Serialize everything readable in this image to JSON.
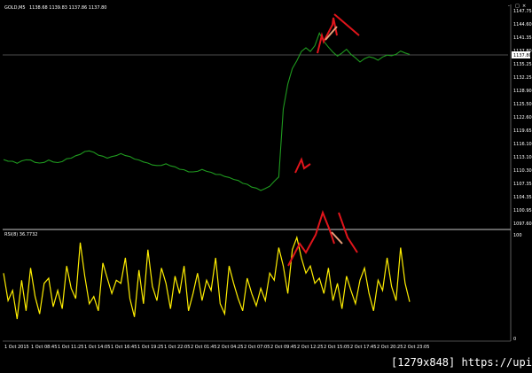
{
  "window": {
    "symbol": "GOLD,M5",
    "ohlc": "1138.68 1139.83 1137.86 1137.80",
    "controls": [
      "-",
      "□",
      "×"
    ]
  },
  "indicator": {
    "label": "RSI(8) 36.7732",
    "max_label": "100",
    "min_label": "0"
  },
  "price_axis": {
    "labels": [
      "1147.75",
      "1144.60",
      "1141.35",
      "1137.80",
      "1135.25",
      "1132.25",
      "1128.90",
      "1125.50",
      "1122.60",
      "1119.65",
      "1116.10",
      "1113.10",
      "1110.30",
      "1107.35",
      "1104.35",
      "1100.95",
      "1097.60"
    ],
    "current_price": "1137.80"
  },
  "time_axis": {
    "labels": [
      "1 Oct 2015",
      "1 Oct 08:45",
      "1 Oct 11:25",
      "1 Oct 14:05",
      "1 Oct 16:45",
      "1 Oct 19:25",
      "1 Oct 22:05",
      "2 Oct 01:45",
      "2 Oct 04:25",
      "2 Oct 07:05",
      "2 Oct 09:45",
      "2 Oct 12:25",
      "2 Oct 15:05",
      "2 Oct 17:45",
      "2 Oct 20:25",
      "2 Oct 23:05"
    ]
  },
  "watermark": "[1279x848] https://upic.me/",
  "colors": {
    "background": "#000000",
    "price_line": "#1f9a1f",
    "rsi_line": "#ffee00",
    "annotation": "#e0151b",
    "annotation_alt": "#e8a07a",
    "separator": "#c8c8c8",
    "price_marker_bg": "#ffffff"
  },
  "chart_data": [
    {
      "type": "line",
      "title": "GOLD,M5",
      "series": [
        {
          "name": "GOLD,M5",
          "values": [
            1113.1,
            1112.9,
            1112.7,
            1112.4,
            1112.8,
            1113.2,
            1113.0,
            1112.6,
            1112.3,
            1112.6,
            1113.0,
            1112.7,
            1112.4,
            1112.8,
            1113.3,
            1113.6,
            1114.0,
            1114.5,
            1115.0,
            1115.3,
            1114.8,
            1114.3,
            1113.9,
            1113.6,
            1113.8,
            1114.2,
            1114.5,
            1114.2,
            1113.8,
            1113.4,
            1113.0,
            1112.7,
            1112.3,
            1112.0,
            1111.7,
            1111.9,
            1112.1,
            1111.8,
            1111.4,
            1111.0,
            1110.7,
            1110.4,
            1110.2,
            1110.5,
            1110.8,
            1110.5,
            1110.1,
            1109.8,
            1109.6,
            1109.3,
            1108.9,
            1108.6,
            1108.2,
            1107.7,
            1107.3,
            1106.8,
            1106.4,
            1106.0,
            1106.3,
            1107.0,
            1108.0,
            1109.2,
            1125.0,
            1131.0,
            1134.5,
            1136.5,
            1138.5,
            1139.5,
            1138.5,
            1140.0,
            1142.8,
            1141.0,
            1139.5,
            1138.5,
            1137.4,
            1138.3,
            1139.0,
            1138.0,
            1137.0,
            1136.2,
            1136.8,
            1137.4,
            1137.0,
            1136.6,
            1137.2,
            1137.8,
            1137.5,
            1138.0,
            1138.6,
            1138.3,
            1137.8
          ]
        }
      ],
      "ylim": [
        1097.6,
        1147.75
      ]
    },
    {
      "type": "line",
      "title": "RSI(8) 36.7732",
      "series": [
        {
          "name": "RSI(8)",
          "values": [
            65,
            38,
            48,
            20,
            58,
            28,
            70,
            42,
            25,
            55,
            60,
            32,
            48,
            30,
            72,
            50,
            40,
            95,
            62,
            35,
            42,
            28,
            75,
            60,
            45,
            58,
            55,
            80,
            40,
            22,
            68,
            35,
            88,
            52,
            38,
            70,
            55,
            30,
            62,
            45,
            72,
            28,
            45,
            65,
            38,
            58,
            48,
            80,
            35,
            25,
            72,
            55,
            40,
            28,
            60,
            45,
            33,
            50,
            38,
            65,
            58,
            90,
            72,
            45,
            88,
            100,
            80,
            65,
            72,
            55,
            60,
            45,
            70,
            38,
            55,
            30,
            62,
            48,
            35,
            58,
            70,
            45,
            28,
            58,
            48,
            80,
            52,
            38,
            90,
            55,
            36.77
          ],
          "levels": [
            100,
            0
          ]
        }
      ],
      "ylim": [
        0,
        100
      ]
    }
  ]
}
